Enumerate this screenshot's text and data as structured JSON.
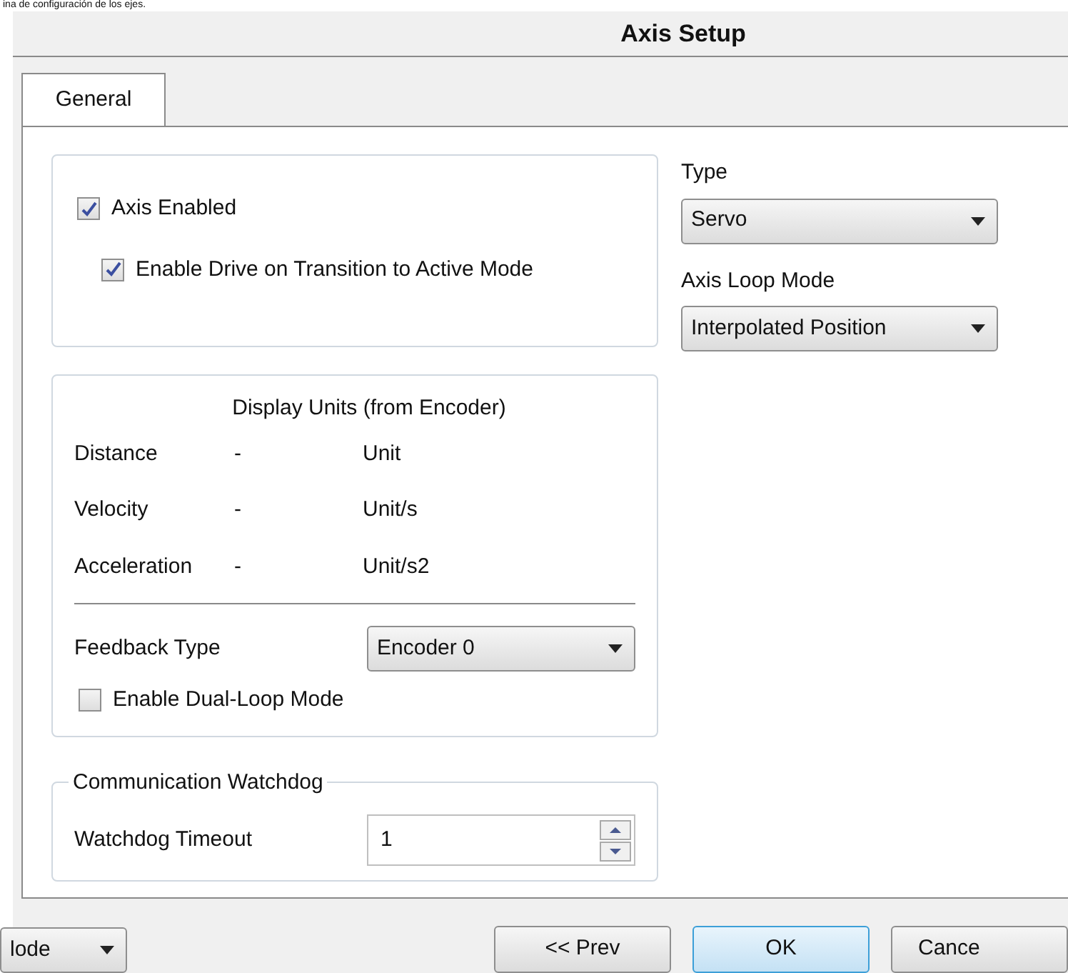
{
  "caption": "ina de configuración de los ejes.",
  "window": {
    "title": "Axis Setup"
  },
  "tabs": [
    {
      "label": "General",
      "selected": true
    }
  ],
  "enable_group": {
    "checkboxes": [
      {
        "label": "Axis Enabled",
        "checked": true
      },
      {
        "label": "Enable Drive on Transition to Active Mode",
        "checked": true
      }
    ]
  },
  "type": {
    "label": "Type",
    "value": "Servo"
  },
  "axis_loop_mode": {
    "label": "Axis Loop Mode",
    "value": "Interpolated Position"
  },
  "display_units": {
    "title": "Display Units (from Encoder)",
    "rows": [
      {
        "name": "Distance",
        "separator": "-",
        "unit": "Unit"
      },
      {
        "name": "Velocity",
        "separator": "-",
        "unit": "Unit/s"
      },
      {
        "name": "Acceleration",
        "separator": "-",
        "unit": "Unit/s2"
      }
    ],
    "feedback_type": {
      "label": "Feedback Type",
      "value": "Encoder 0"
    },
    "dual_loop": {
      "label": "Enable Dual-Loop Mode",
      "checked": false
    }
  },
  "watchdog": {
    "title": "Communication Watchdog",
    "label": "Watchdog Timeout",
    "value": "1"
  },
  "footer": {
    "mode_dropdown": "lode",
    "buttons": [
      {
        "label": "<<  Prev",
        "kind": "normal"
      },
      {
        "label": "OK",
        "kind": "default"
      },
      {
        "label": "Cance",
        "kind": "normal"
      }
    ]
  }
}
